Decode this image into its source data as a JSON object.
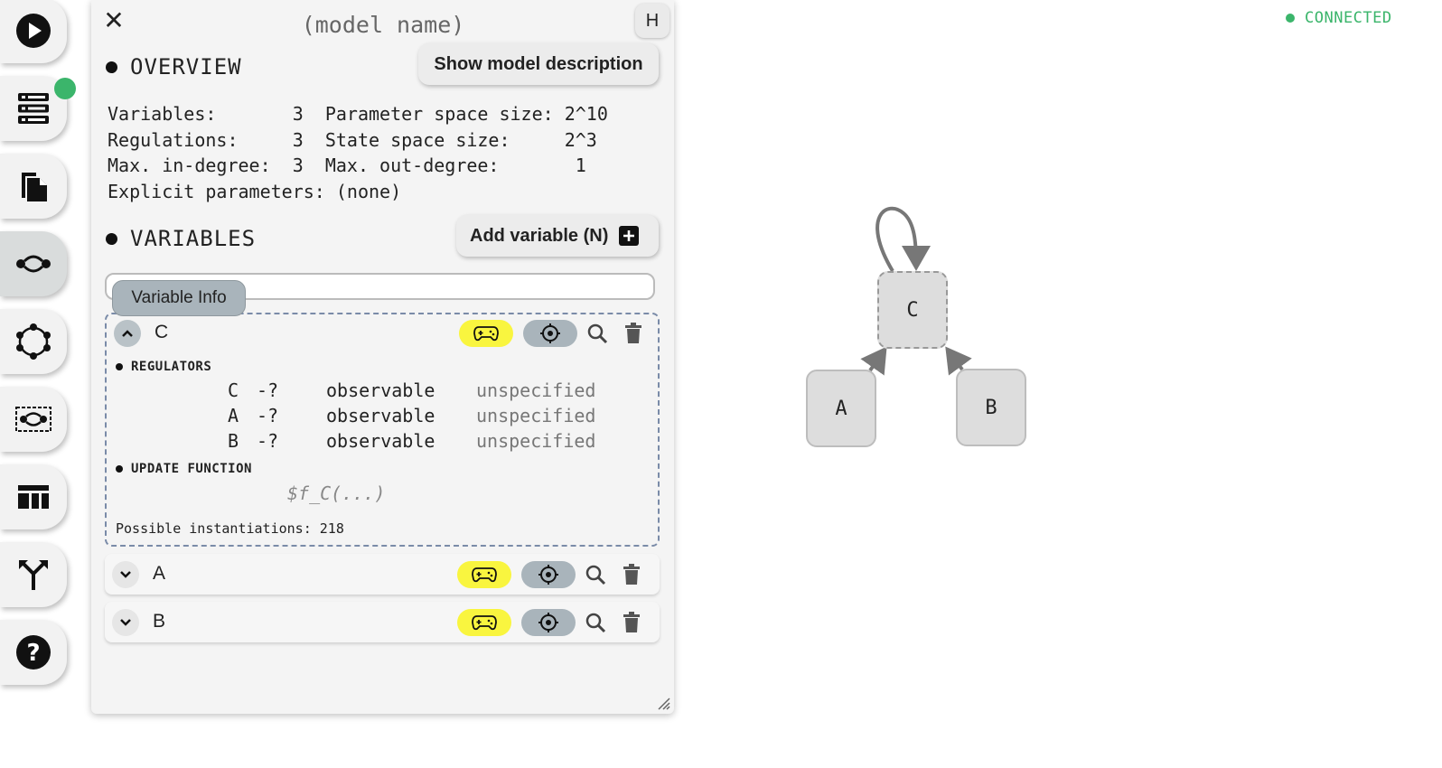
{
  "dock": {
    "items": [
      {
        "id": "run",
        "icon": "play-icon"
      },
      {
        "id": "servers",
        "icon": "server-list-icon",
        "badge_color": "#3bb56b"
      },
      {
        "id": "files",
        "icon": "documents-icon"
      },
      {
        "id": "model-editor",
        "icon": "model-editor-icon",
        "active": true
      },
      {
        "id": "network",
        "icon": "network-icon"
      },
      {
        "id": "regulations",
        "icon": "regulations-icon"
      },
      {
        "id": "dashboard",
        "icon": "dashboard-icon"
      },
      {
        "id": "merge",
        "icon": "merge-icon"
      },
      {
        "id": "help",
        "icon": "help-icon"
      }
    ]
  },
  "panel": {
    "close": "✕",
    "model_name_placeholder": "(model name)",
    "hotkey_button": "H",
    "overview": {
      "title": "OVERVIEW",
      "description_button": "Show model description",
      "rows": [
        "Variables:       3  Parameter space size: 2^10",
        "Regulations:     3  State space size:     2^3",
        "Max. in-degree:  3  Max. out-degree:       1",
        "Explicit parameters: (none)"
      ]
    },
    "variables": {
      "title": "VARIABLES",
      "add_button": "Add variable (N)",
      "tooltip": "Variable Info",
      "items": [
        {
          "name": "C",
          "expanded": true,
          "regulators_title": "REGULATORS",
          "regulators": [
            {
              "source": "C",
              "arrow": "-?",
              "observable": "observable",
              "monotonicity": "unspecified"
            },
            {
              "source": "A",
              "arrow": "-?",
              "observable": "observable",
              "monotonicity": "unspecified"
            },
            {
              "source": "B",
              "arrow": "-?",
              "observable": "observable",
              "monotonicity": "unspecified"
            }
          ],
          "update_title": "UPDATE FUNCTION",
          "update_function_placeholder": "$f_C(...)",
          "instantiations": "Possible instantiations: 218"
        },
        {
          "name": "A",
          "expanded": false
        },
        {
          "name": "B",
          "expanded": false
        }
      ]
    }
  },
  "graph": {
    "status": "CONNECTED",
    "status_color": "#3bb56b",
    "nodes": [
      "C",
      "A",
      "B"
    ]
  }
}
